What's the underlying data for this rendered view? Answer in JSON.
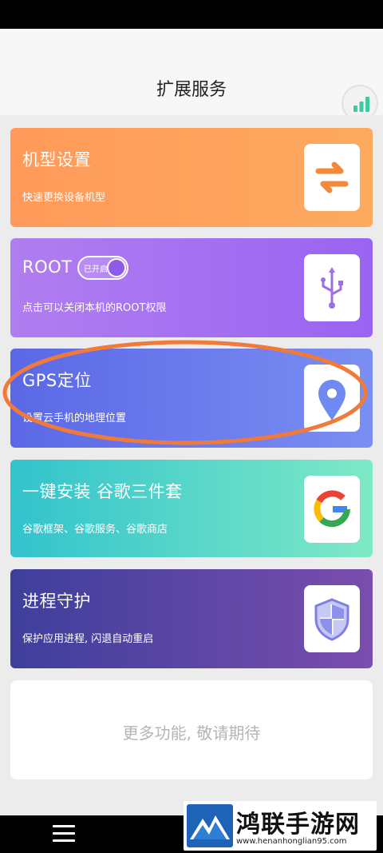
{
  "header": {
    "title": "扩展服务"
  },
  "cards": [
    {
      "title": "机型设置",
      "subtitle": "快速更换设备机型",
      "icon": "swap-arrows-icon"
    },
    {
      "title": "ROOT",
      "subtitle": "点击可以关闭本机的ROOT权限",
      "icon": "usb-icon",
      "toggle_label": "已开启"
    },
    {
      "title": "GPS定位",
      "subtitle": "设置云手机的地理位置",
      "icon": "location-pin-icon"
    },
    {
      "title": "一键安装 谷歌三件套",
      "subtitle": "谷歌框架、谷歌服务、谷歌商店",
      "icon": "google-icon"
    },
    {
      "title": "进程守护",
      "subtitle": "保护应用进程, 闪退自动重启",
      "icon": "shield-icon"
    }
  ],
  "more": {
    "text": "更多功能, 敬请期待"
  },
  "watermark": {
    "title": "鸿联手游网",
    "url": "www.henanhonglian95.com"
  },
  "colors": {
    "model_card": "#fda05c",
    "root_card": "#a66ff1",
    "gps_card": "#6a7cec",
    "google_card": "#55d6c9",
    "process_card": "#5a46a5",
    "annotation": "#f07a3a"
  }
}
